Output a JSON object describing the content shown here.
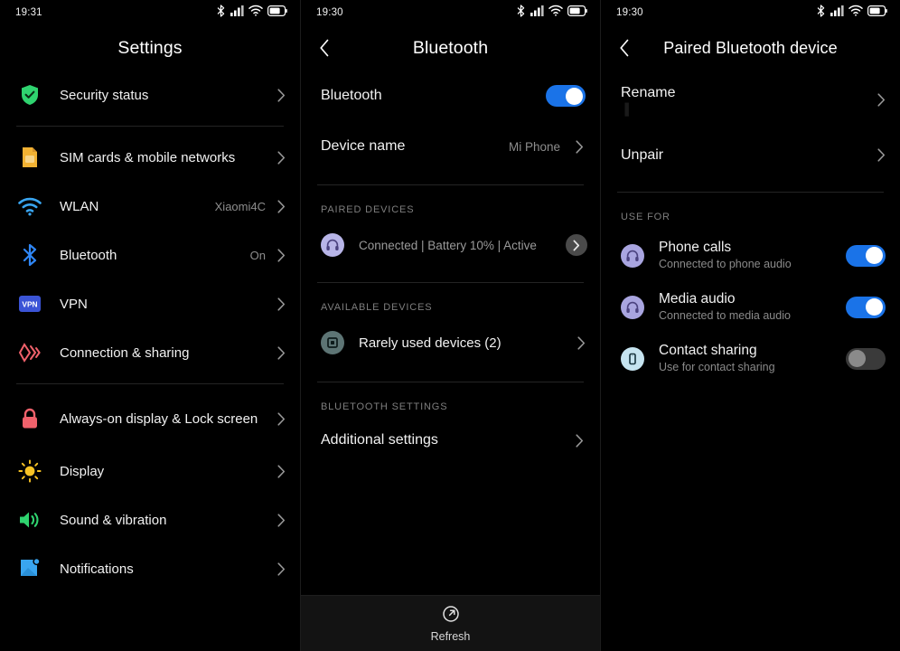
{
  "panels": {
    "settings": {
      "status": {
        "time": "19:31",
        "icons": [
          "bluetooth-icon",
          "signal-icon",
          "wifi-icon",
          "battery-icon"
        ]
      },
      "title": "Settings",
      "items": [
        {
          "label": "Security status",
          "value": "",
          "icon": "shield-check-icon",
          "color": "#2fd36f"
        },
        {
          "label": "SIM cards & mobile networks",
          "value": "",
          "icon": "sim-card-icon",
          "color": "#f2b233"
        },
        {
          "label": "WLAN",
          "value": "Xiaomi4C",
          "icon": "wifi-icon",
          "color": "#39a5f0"
        },
        {
          "label": "Bluetooth",
          "value": "On",
          "icon": "bluetooth-icon",
          "color": "#2f86f5"
        },
        {
          "label": "VPN",
          "value": "",
          "icon": "vpn-icon",
          "color": "#3b54d6"
        },
        {
          "label": "Connection & sharing",
          "value": "",
          "icon": "connection-sharing-icon",
          "color": "#f0616b"
        },
        {
          "label": "Always-on display & Lock screen",
          "value": "",
          "icon": "lock-icon",
          "color": "#f0616b"
        },
        {
          "label": "Display",
          "value": "",
          "icon": "brightness-icon",
          "color": "#f7c325"
        },
        {
          "label": "Sound & vibration",
          "value": "",
          "icon": "speaker-icon",
          "color": "#2fd36f"
        },
        {
          "label": "Notifications",
          "value": "",
          "icon": "notifications-icon",
          "color": "#39a5f0"
        }
      ],
      "dividers_after": [
        0,
        5
      ]
    },
    "bluetooth": {
      "status": {
        "time": "19:30"
      },
      "title": "Bluetooth",
      "back": "back-arrow",
      "toggle_row": {
        "label": "Bluetooth",
        "state": "on"
      },
      "device_name_row": {
        "label": "Device name",
        "value": "Mi Phone"
      },
      "paired_section": {
        "label": "PAIRED DEVICES"
      },
      "paired_device": {
        "name": "",
        "status": "Connected | Battery 10% | Active",
        "icon": "headset-icon"
      },
      "available_section": {
        "label": "AVAILABLE DEVICES"
      },
      "available_items": [
        {
          "label": "Rarely used devices (2)",
          "icon": "rarely-used-devices-icon"
        }
      ],
      "settings_section": {
        "label": "BLUETOOTH SETTINGS"
      },
      "settings_items": [
        {
          "label": "Additional settings"
        }
      ],
      "refresh": {
        "label": "Refresh",
        "icon": "refresh-icon"
      }
    },
    "paired_device": {
      "status": {
        "time": "19:30"
      },
      "title": "Paired Bluetooth device",
      "back": "back-arrow",
      "actions": [
        {
          "label": "Rename",
          "sub": "▐"
        },
        {
          "label": "Unpair",
          "sub": ""
        }
      ],
      "use_for_section": {
        "label": "USE FOR"
      },
      "use_for": [
        {
          "label": "Phone calls",
          "sub": "Connected to phone audio",
          "icon": "headset-icon",
          "state": "on"
        },
        {
          "label": "Media audio",
          "sub": "Connected to media audio",
          "icon": "headset-icon",
          "state": "on"
        },
        {
          "label": "Contact sharing",
          "sub": "Use for contact sharing",
          "icon": "contact-sharing-icon",
          "state": "off"
        }
      ]
    }
  },
  "theme": {
    "accent_on": "#1a73e8",
    "toggle_off": "#3a3a3a",
    "background": "#000000",
    "divider": "#242424"
  }
}
